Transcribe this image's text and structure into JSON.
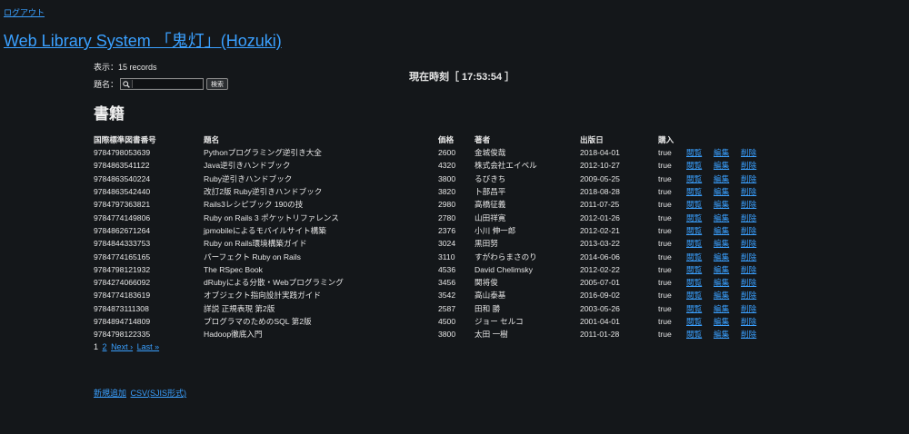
{
  "nav": {
    "logout": "ログアウト"
  },
  "site": {
    "title": "Web Library System 「鬼灯」(Hozuki)"
  },
  "status": {
    "count": "表示：15 records",
    "clock": "現在時刻［ 17:53:54 ］"
  },
  "search": {
    "label": "題名：",
    "value": "",
    "button": "検索"
  },
  "section": {
    "title": "書籍"
  },
  "table": {
    "headers": [
      "国際標準図書番号",
      "題名",
      "価格",
      "著者",
      "出版日",
      "購入"
    ],
    "action_labels": {
      "view": "閲覧",
      "edit": "編集",
      "delete": "削除"
    },
    "rows": [
      {
        "isbn": "9784798053639",
        "title": "Pythonプログラミング逆引き大全",
        "price": "2600",
        "author": "金城俊哉",
        "date": "2018-04-01",
        "buy": "true"
      },
      {
        "isbn": "9784863541122",
        "title": "Java逆引きハンドブック",
        "price": "4320",
        "author": "株式会社エイベル",
        "date": "2012-10-27",
        "buy": "true"
      },
      {
        "isbn": "9784863540224",
        "title": "Ruby逆引きハンドブック",
        "price": "3800",
        "author": "るびきち",
        "date": "2009-05-25",
        "buy": "true"
      },
      {
        "isbn": "9784863542440",
        "title": "改訂2版 Ruby逆引きハンドブック",
        "price": "3820",
        "author": "卜部昌平",
        "date": "2018-08-28",
        "buy": "true"
      },
      {
        "isbn": "9784797363821",
        "title": "Rails3レシピブック 190の技",
        "price": "2980",
        "author": "高橋征義",
        "date": "2011-07-25",
        "buy": "true"
      },
      {
        "isbn": "9784774149806",
        "title": "Ruby on Rails 3 ポケットリファレンス",
        "price": "2780",
        "author": "山田祥寛",
        "date": "2012-01-26",
        "buy": "true"
      },
      {
        "isbn": "9784862671264",
        "title": "jpmobileによるモバイルサイト構築",
        "price": "2376",
        "author": "小川 伸一郎",
        "date": "2012-02-21",
        "buy": "true"
      },
      {
        "isbn": "9784844333753",
        "title": "Ruby on Rails環境構築ガイド",
        "price": "3024",
        "author": "黒田努",
        "date": "2013-03-22",
        "buy": "true"
      },
      {
        "isbn": "9784774165165",
        "title": "パーフェクト Ruby on Rails",
        "price": "3110",
        "author": "すがわらまさのり",
        "date": "2014-06-06",
        "buy": "true"
      },
      {
        "isbn": "9784798121932",
        "title": "The RSpec Book",
        "price": "4536",
        "author": "David Chelimsky",
        "date": "2012-02-22",
        "buy": "true"
      },
      {
        "isbn": "9784274066092",
        "title": "dRubyによる分散・Webプログラミング",
        "price": "3456",
        "author": "関将俊",
        "date": "2005-07-01",
        "buy": "true"
      },
      {
        "isbn": "9784774183619",
        "title": "オブジェクト指向設計実践ガイド",
        "price": "3542",
        "author": "高山泰基",
        "date": "2016-09-02",
        "buy": "true"
      },
      {
        "isbn": "9784873111308",
        "title": "詳説 正規表現 第2版",
        "price": "2587",
        "author": "田和 勝",
        "date": "2003-05-26",
        "buy": "true"
      },
      {
        "isbn": "9784894714809",
        "title": "プログラマのためのSQL 第2版",
        "price": "4500",
        "author": "ジョー セルコ",
        "date": "2001-04-01",
        "buy": "true"
      },
      {
        "isbn": "9784798122335",
        "title": "Hadoop徹底入門",
        "price": "3800",
        "author": "太田 一樹",
        "date": "2011-01-28",
        "buy": "true"
      }
    ]
  },
  "pagination": {
    "current": "1",
    "page2": "2",
    "next": "Next ›",
    "last": "Last »"
  },
  "footer": {
    "new": "新規追加",
    "csv": "CSV(SJIS形式)"
  }
}
